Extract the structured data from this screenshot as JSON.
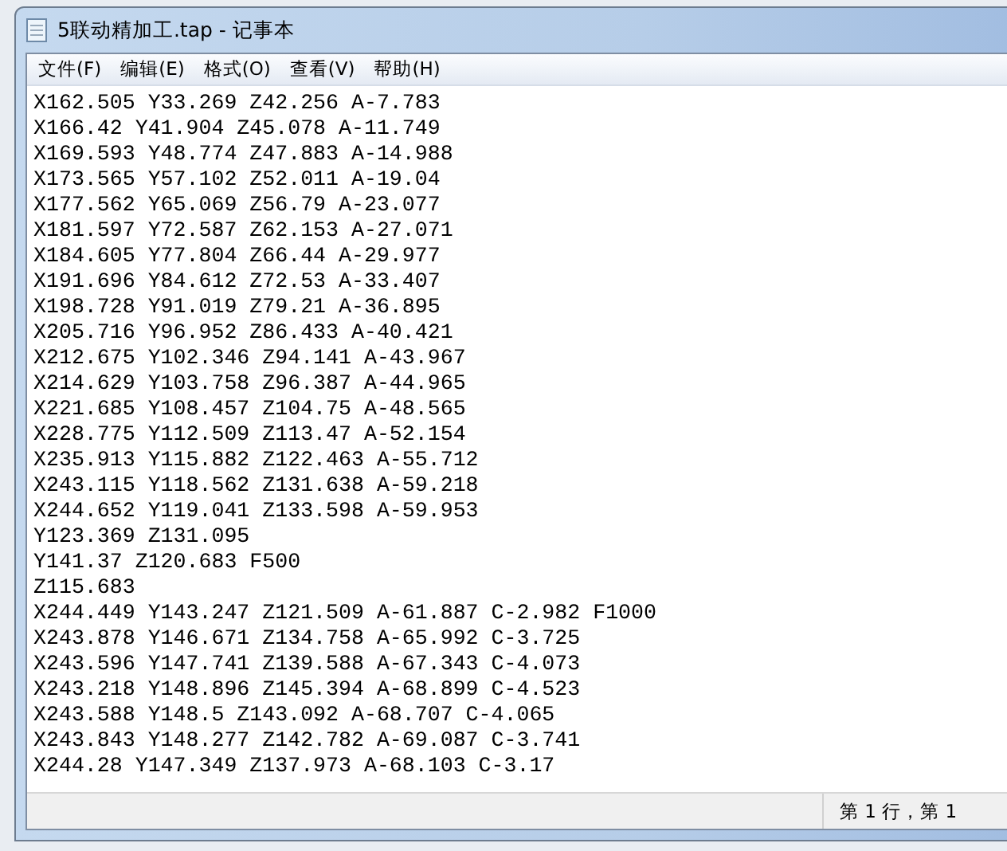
{
  "window": {
    "title": "5联动精加工.tap - 记事本"
  },
  "menu": [
    "文件(F)",
    "编辑(E)",
    "格式(O)",
    "查看(V)",
    "帮助(H)"
  ],
  "lines": [
    "X162.505 Y33.269 Z42.256 A-7.783",
    "X166.42 Y41.904 Z45.078 A-11.749",
    "X169.593 Y48.774 Z47.883 A-14.988",
    "X173.565 Y57.102 Z52.011 A-19.04",
    "X177.562 Y65.069 Z56.79 A-23.077",
    "X181.597 Y72.587 Z62.153 A-27.071",
    "X184.605 Y77.804 Z66.44 A-29.977",
    "X191.696 Y84.612 Z72.53 A-33.407",
    "X198.728 Y91.019 Z79.21 A-36.895",
    "X205.716 Y96.952 Z86.433 A-40.421",
    "X212.675 Y102.346 Z94.141 A-43.967",
    "X214.629 Y103.758 Z96.387 A-44.965",
    "X221.685 Y108.457 Z104.75 A-48.565",
    "X228.775 Y112.509 Z113.47 A-52.154",
    "X235.913 Y115.882 Z122.463 A-55.712",
    "X243.115 Y118.562 Z131.638 A-59.218",
    "X244.652 Y119.041 Z133.598 A-59.953",
    "Y123.369 Z131.095",
    "Y141.37 Z120.683 F500",
    "Z115.683",
    "X244.449 Y143.247 Z121.509 A-61.887 C-2.982 F1000",
    "X243.878 Y146.671 Z134.758 A-65.992 C-3.725",
    "X243.596 Y147.741 Z139.588 A-67.343 C-4.073",
    "X243.218 Y148.896 Z145.394 A-68.899 C-4.523",
    "X243.588 Y148.5 Z143.092 A-68.707 C-4.065",
    "X243.843 Y148.277 Z142.782 A-69.087 C-3.741",
    "X244.28 Y147.349 Z137.973 A-68.103 C-3.17"
  ],
  "status_bar": {
    "position": "第 1 行，第 1"
  }
}
